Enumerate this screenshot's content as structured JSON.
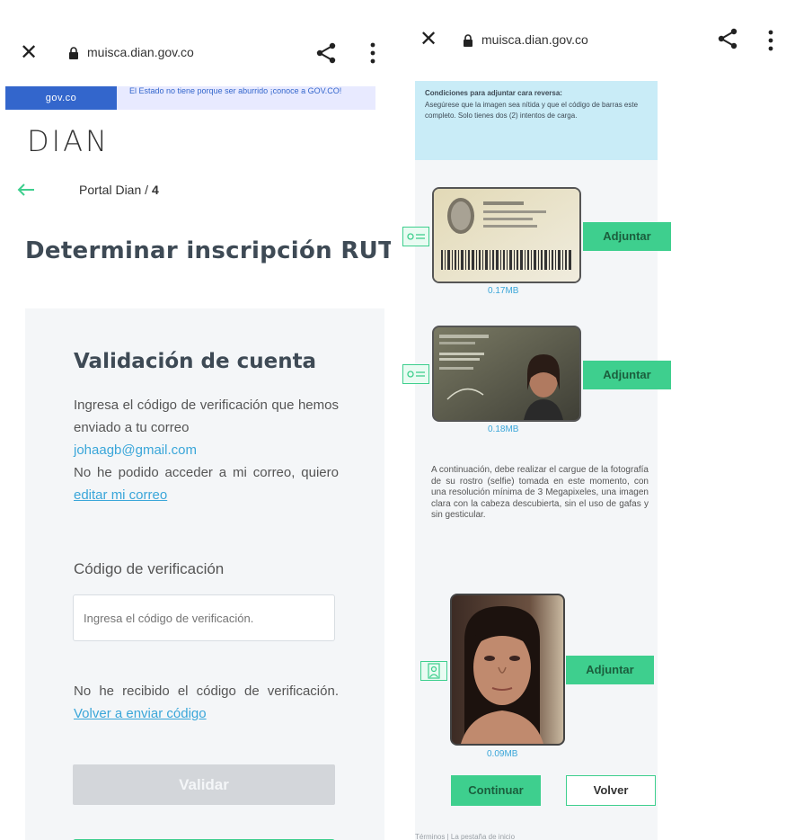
{
  "left_screen": {
    "browser": {
      "url": "muisca.dian.gov.co"
    },
    "gov_banner": {
      "logo": "gov.co",
      "text": "El Estado no tiene porque ser aburrido ¡conoce a GOV.CO!"
    },
    "brand": "DIAN",
    "breadcrumb": {
      "parent": "Portal Dian /",
      "current": "4"
    },
    "page_title": "Determinar inscripción RUT",
    "card": {
      "title": "Validación de cuenta",
      "instruction": "Ingresa el código de verificación que hemos enviado a tu correo",
      "email": "johaagb@gmail.com",
      "no_access_text": "No he podido acceder a mi correo, quiero",
      "edit_email_link": "editar mi correo",
      "field_label": "Código de verificación",
      "input_placeholder": "Ingresa el código de verificación.",
      "not_received_text": "No he recibido el código de verificación.",
      "resend_link": "Volver a enviar código",
      "validate_button": "Validar"
    }
  },
  "right_screen": {
    "browser": {
      "url": "muisca.dian.gov.co"
    },
    "conditions": {
      "heading": "Condiciones para adjuntar cara reversa:",
      "text": "Asegúrese que la imagen sea nítida y que el código de barras este completo. Solo tienes dos (2) intentos de carga."
    },
    "uploads": [
      {
        "button": "Adjuntar",
        "size": "0.17MB"
      },
      {
        "button": "Adjuntar",
        "size": "0.18MB"
      },
      {
        "button": "Adjuntar",
        "size": "0.09MB"
      }
    ],
    "selfie_instructions": "A continuación, debe realizar el cargue de la fotografía de su rostro (selfie) tomada en este momento, con una resolución mínima de 3 Megapixeles, una imagen clara con la cabeza descubierta, sin el uso de gafas y sin gesticular.",
    "continue_button": "Continuar",
    "back_button": "Volver",
    "footer": "Términos | La pestaña de inicio"
  },
  "colors": {
    "accent_green": "#3ecf8e",
    "link_blue": "#3aa6d9",
    "gov_blue": "#3366cc",
    "info_bg": "#c9ecf7",
    "card_bg": "#f4f6f8"
  },
  "icons": [
    "close-icon",
    "lock-icon",
    "share-icon",
    "kebab-menu-icon",
    "back-arrow-icon",
    "id-card-icon",
    "person-card-icon"
  ]
}
